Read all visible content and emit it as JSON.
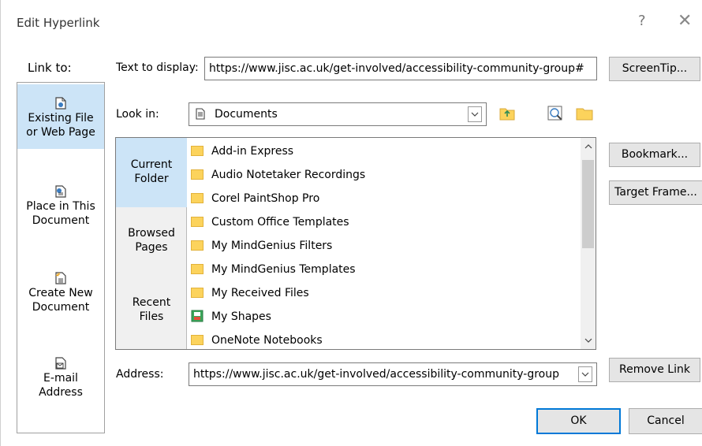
{
  "window": {
    "title": "Edit Hyperlink",
    "help_glyph": "?",
    "close_glyph": "✕"
  },
  "sidebar": {
    "label": "Link to:",
    "items": [
      {
        "line1": "Existing File",
        "line2": "or Web Page",
        "icon": "existing-file-icon",
        "active": true
      },
      {
        "line1": "Place in This",
        "line2": "Document",
        "icon": "place-in-document-icon",
        "active": false
      },
      {
        "line1": "Create New",
        "line2": "Document",
        "icon": "new-document-icon",
        "active": false
      },
      {
        "line1": "E-mail",
        "line2": "Address",
        "icon": "email-address-icon",
        "active": false
      }
    ]
  },
  "text_to_display": {
    "label": "Text to display:",
    "value": "https://www.jisc.ac.uk/get-involved/accessibility-community-group#"
  },
  "look_in": {
    "label": "Look in:",
    "value": "Documents"
  },
  "browse_modes": [
    {
      "line1": "Current",
      "line2": "Folder",
      "active": true
    },
    {
      "line1": "Browsed",
      "line2": "Pages",
      "active": false
    },
    {
      "line1": "Recent",
      "line2": "Files",
      "active": false
    }
  ],
  "files": [
    {
      "name": "Add-in Express",
      "type": "folder"
    },
    {
      "name": "Audio Notetaker Recordings",
      "type": "folder"
    },
    {
      "name": "Corel PaintShop Pro",
      "type": "folder"
    },
    {
      "name": "Custom Office Templates",
      "type": "folder"
    },
    {
      "name": "My MindGenius Filters",
      "type": "folder"
    },
    {
      "name": "My MindGenius Templates",
      "type": "folder"
    },
    {
      "name": "My Received Files",
      "type": "folder"
    },
    {
      "name": "My Shapes",
      "type": "shapes"
    },
    {
      "name": "OneNote Notebooks",
      "type": "folder"
    }
  ],
  "address": {
    "label": "Address:",
    "value": "https://www.jisc.ac.uk/get-involved/accessibility-community-group"
  },
  "buttons": {
    "screentip": "ScreenTip...",
    "bookmark": "Bookmark...",
    "target_frame": "Target Frame...",
    "remove_link": "Remove Link",
    "ok": "OK",
    "cancel": "Cancel"
  },
  "colors": {
    "selected_background": "#cce4f7",
    "ok_border": "#0078d7",
    "folder_fill": "#fcd35c"
  }
}
